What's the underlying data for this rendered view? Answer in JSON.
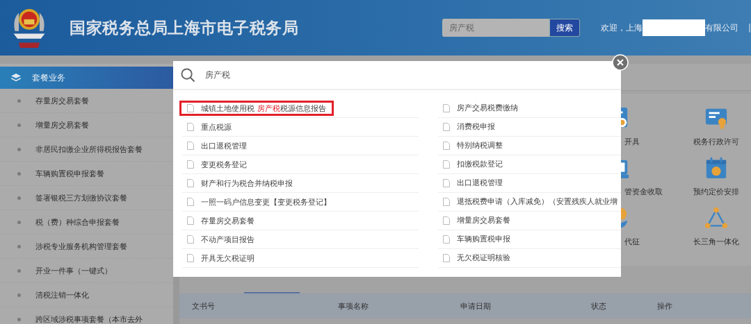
{
  "header": {
    "title": "国家税务总局上海市电子税务局",
    "search": {
      "value": "房产税"
    },
    "search_button": "搜索",
    "welcome_prefix": "欢迎，上海",
    "welcome_suffix": "有限公司",
    "separator": "|"
  },
  "sidebar": {
    "title": "套餐业务",
    "items": [
      {
        "label": "存量房交易套餐"
      },
      {
        "label": "增量房交易套餐"
      },
      {
        "label": "非居民扣缴企业所得税报告套餐"
      },
      {
        "label": "车辆购置税申报套餐"
      },
      {
        "label": "签署银税三方划缴协议套餐"
      },
      {
        "label": "税（费）种综合申报套餐"
      },
      {
        "label": "涉税专业服务机构管理套餐"
      },
      {
        "label": "开业一件事（一键式）"
      },
      {
        "label": "清税注销一体化"
      },
      {
        "label": "跨区域涉税事项套餐（本市去外"
      }
    ]
  },
  "services": [
    {
      "label": "开具",
      "kind": "certificate"
    },
    {
      "label": "税务行政许可",
      "kind": "award"
    },
    {
      "label": "管资金收取",
      "kind": "money"
    },
    {
      "label": "预约定价安排",
      "kind": "calendar"
    },
    {
      "label": "代征",
      "kind": "hand"
    },
    {
      "label": "长三角一体化",
      "kind": "triangle"
    }
  ],
  "table": {
    "columns": [
      "文书号",
      "事项名称",
      "申请日期",
      "状态",
      "操作"
    ]
  },
  "modal": {
    "query": "房产税",
    "results_left": [
      {
        "text": "城镇土地使用税 ",
        "match": "房产税",
        "rest": "税源信息报告",
        "highlighted": true
      },
      {
        "text": "重点税源",
        "highlighted": false
      },
      {
        "text": "出口退税管理",
        "highlighted": false
      },
      {
        "text": "变更税务登记",
        "highlighted": false
      },
      {
        "text": "财产和行为税合并纳税申报",
        "highlighted": false
      },
      {
        "text": "一照一码户信息变更【变更税务登记】",
        "highlighted": false
      },
      {
        "text": "存量房交易套餐",
        "highlighted": false
      },
      {
        "text": "不动产项目报告",
        "highlighted": false
      },
      {
        "text": "开具无欠税证明",
        "highlighted": false
      }
    ],
    "results_right": [
      {
        "text": "房产交易税费缴纳",
        "highlighted": false
      },
      {
        "text": "消费税申报",
        "highlighted": false
      },
      {
        "text": "特别纳税调整",
        "highlighted": false
      },
      {
        "text": "扣缴税款登记",
        "highlighted": false
      },
      {
        "text": "出口退税管理",
        "highlighted": false
      },
      {
        "text": "退抵税费申请（入库减免）（安置残疾人就业增",
        "highlighted": false
      },
      {
        "text": "增量房交易套餐",
        "highlighted": false
      },
      {
        "text": "车辆购置税申报",
        "highlighted": false
      },
      {
        "text": "无欠税证明核验",
        "highlighted": false
      }
    ]
  }
}
